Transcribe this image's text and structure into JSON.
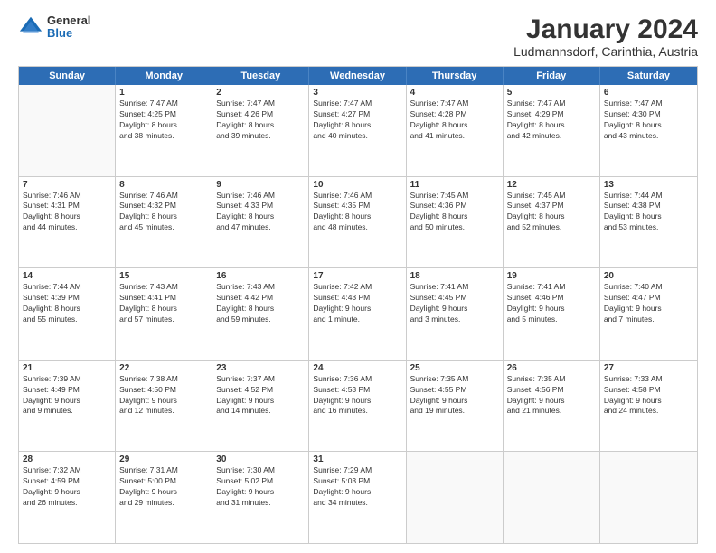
{
  "logo": {
    "general": "General",
    "blue": "Blue"
  },
  "title": {
    "month_year": "January 2024",
    "location": "Ludmannsdorf, Carinthia, Austria"
  },
  "header_days": [
    "Sunday",
    "Monday",
    "Tuesday",
    "Wednesday",
    "Thursday",
    "Friday",
    "Saturday"
  ],
  "weeks": [
    [
      {
        "day": "",
        "sunrise": "",
        "sunset": "",
        "daylight": "",
        "empty": true
      },
      {
        "day": "1",
        "sunrise": "Sunrise: 7:47 AM",
        "sunset": "Sunset: 4:25 PM",
        "daylight": "Daylight: 8 hours",
        "daylight2": "and 38 minutes."
      },
      {
        "day": "2",
        "sunrise": "Sunrise: 7:47 AM",
        "sunset": "Sunset: 4:26 PM",
        "daylight": "Daylight: 8 hours",
        "daylight2": "and 39 minutes."
      },
      {
        "day": "3",
        "sunrise": "Sunrise: 7:47 AM",
        "sunset": "Sunset: 4:27 PM",
        "daylight": "Daylight: 8 hours",
        "daylight2": "and 40 minutes."
      },
      {
        "day": "4",
        "sunrise": "Sunrise: 7:47 AM",
        "sunset": "Sunset: 4:28 PM",
        "daylight": "Daylight: 8 hours",
        "daylight2": "and 41 minutes."
      },
      {
        "day": "5",
        "sunrise": "Sunrise: 7:47 AM",
        "sunset": "Sunset: 4:29 PM",
        "daylight": "Daylight: 8 hours",
        "daylight2": "and 42 minutes."
      },
      {
        "day": "6",
        "sunrise": "Sunrise: 7:47 AM",
        "sunset": "Sunset: 4:30 PM",
        "daylight": "Daylight: 8 hours",
        "daylight2": "and 43 minutes."
      }
    ],
    [
      {
        "day": "7",
        "sunrise": "Sunrise: 7:46 AM",
        "sunset": "Sunset: 4:31 PM",
        "daylight": "Daylight: 8 hours",
        "daylight2": "and 44 minutes."
      },
      {
        "day": "8",
        "sunrise": "Sunrise: 7:46 AM",
        "sunset": "Sunset: 4:32 PM",
        "daylight": "Daylight: 8 hours",
        "daylight2": "and 45 minutes."
      },
      {
        "day": "9",
        "sunrise": "Sunrise: 7:46 AM",
        "sunset": "Sunset: 4:33 PM",
        "daylight": "Daylight: 8 hours",
        "daylight2": "and 47 minutes."
      },
      {
        "day": "10",
        "sunrise": "Sunrise: 7:46 AM",
        "sunset": "Sunset: 4:35 PM",
        "daylight": "Daylight: 8 hours",
        "daylight2": "and 48 minutes."
      },
      {
        "day": "11",
        "sunrise": "Sunrise: 7:45 AM",
        "sunset": "Sunset: 4:36 PM",
        "daylight": "Daylight: 8 hours",
        "daylight2": "and 50 minutes."
      },
      {
        "day": "12",
        "sunrise": "Sunrise: 7:45 AM",
        "sunset": "Sunset: 4:37 PM",
        "daylight": "Daylight: 8 hours",
        "daylight2": "and 52 minutes."
      },
      {
        "day": "13",
        "sunrise": "Sunrise: 7:44 AM",
        "sunset": "Sunset: 4:38 PM",
        "daylight": "Daylight: 8 hours",
        "daylight2": "and 53 minutes."
      }
    ],
    [
      {
        "day": "14",
        "sunrise": "Sunrise: 7:44 AM",
        "sunset": "Sunset: 4:39 PM",
        "daylight": "Daylight: 8 hours",
        "daylight2": "and 55 minutes."
      },
      {
        "day": "15",
        "sunrise": "Sunrise: 7:43 AM",
        "sunset": "Sunset: 4:41 PM",
        "daylight": "Daylight: 8 hours",
        "daylight2": "and 57 minutes."
      },
      {
        "day": "16",
        "sunrise": "Sunrise: 7:43 AM",
        "sunset": "Sunset: 4:42 PM",
        "daylight": "Daylight: 8 hours",
        "daylight2": "and 59 minutes."
      },
      {
        "day": "17",
        "sunrise": "Sunrise: 7:42 AM",
        "sunset": "Sunset: 4:43 PM",
        "daylight": "Daylight: 9 hours",
        "daylight2": "and 1 minute."
      },
      {
        "day": "18",
        "sunrise": "Sunrise: 7:41 AM",
        "sunset": "Sunset: 4:45 PM",
        "daylight": "Daylight: 9 hours",
        "daylight2": "and 3 minutes."
      },
      {
        "day": "19",
        "sunrise": "Sunrise: 7:41 AM",
        "sunset": "Sunset: 4:46 PM",
        "daylight": "Daylight: 9 hours",
        "daylight2": "and 5 minutes."
      },
      {
        "day": "20",
        "sunrise": "Sunrise: 7:40 AM",
        "sunset": "Sunset: 4:47 PM",
        "daylight": "Daylight: 9 hours",
        "daylight2": "and 7 minutes."
      }
    ],
    [
      {
        "day": "21",
        "sunrise": "Sunrise: 7:39 AM",
        "sunset": "Sunset: 4:49 PM",
        "daylight": "Daylight: 9 hours",
        "daylight2": "and 9 minutes."
      },
      {
        "day": "22",
        "sunrise": "Sunrise: 7:38 AM",
        "sunset": "Sunset: 4:50 PM",
        "daylight": "Daylight: 9 hours",
        "daylight2": "and 12 minutes."
      },
      {
        "day": "23",
        "sunrise": "Sunrise: 7:37 AM",
        "sunset": "Sunset: 4:52 PM",
        "daylight": "Daylight: 9 hours",
        "daylight2": "and 14 minutes."
      },
      {
        "day": "24",
        "sunrise": "Sunrise: 7:36 AM",
        "sunset": "Sunset: 4:53 PM",
        "daylight": "Daylight: 9 hours",
        "daylight2": "and 16 minutes."
      },
      {
        "day": "25",
        "sunrise": "Sunrise: 7:35 AM",
        "sunset": "Sunset: 4:55 PM",
        "daylight": "Daylight: 9 hours",
        "daylight2": "and 19 minutes."
      },
      {
        "day": "26",
        "sunrise": "Sunrise: 7:35 AM",
        "sunset": "Sunset: 4:56 PM",
        "daylight": "Daylight: 9 hours",
        "daylight2": "and 21 minutes."
      },
      {
        "day": "27",
        "sunrise": "Sunrise: 7:33 AM",
        "sunset": "Sunset: 4:58 PM",
        "daylight": "Daylight: 9 hours",
        "daylight2": "and 24 minutes."
      }
    ],
    [
      {
        "day": "28",
        "sunrise": "Sunrise: 7:32 AM",
        "sunset": "Sunset: 4:59 PM",
        "daylight": "Daylight: 9 hours",
        "daylight2": "and 26 minutes."
      },
      {
        "day": "29",
        "sunrise": "Sunrise: 7:31 AM",
        "sunset": "Sunset: 5:00 PM",
        "daylight": "Daylight: 9 hours",
        "daylight2": "and 29 minutes."
      },
      {
        "day": "30",
        "sunrise": "Sunrise: 7:30 AM",
        "sunset": "Sunset: 5:02 PM",
        "daylight": "Daylight: 9 hours",
        "daylight2": "and 31 minutes."
      },
      {
        "day": "31",
        "sunrise": "Sunrise: 7:29 AM",
        "sunset": "Sunset: 5:03 PM",
        "daylight": "Daylight: 9 hours",
        "daylight2": "and 34 minutes."
      },
      {
        "day": "",
        "sunrise": "",
        "sunset": "",
        "daylight": "",
        "daylight2": "",
        "empty": true
      },
      {
        "day": "",
        "sunrise": "",
        "sunset": "",
        "daylight": "",
        "daylight2": "",
        "empty": true
      },
      {
        "day": "",
        "sunrise": "",
        "sunset": "",
        "daylight": "",
        "daylight2": "",
        "empty": true
      }
    ]
  ]
}
